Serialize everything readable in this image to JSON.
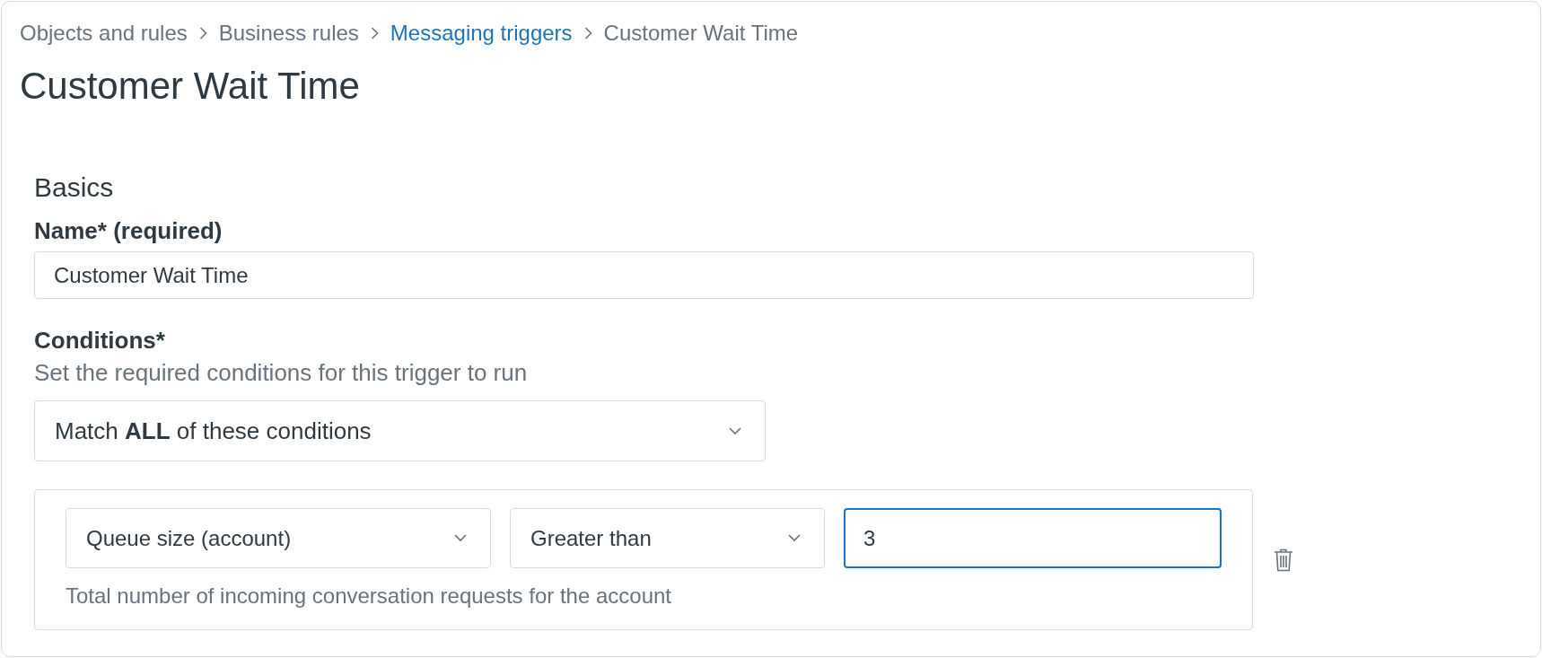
{
  "breadcrumb": [
    {
      "label": "Objects and rules",
      "kind": "text"
    },
    {
      "label": "Business rules",
      "kind": "text"
    },
    {
      "label": "Messaging triggers",
      "kind": "link"
    },
    {
      "label": "Customer Wait Time",
      "kind": "current"
    }
  ],
  "title": "Customer Wait Time",
  "section": "Basics",
  "name_field": {
    "label": "Name* (required)",
    "value": "Customer Wait Time"
  },
  "conditions": {
    "label": "Conditions*",
    "description": "Set the required conditions for this trigger to run",
    "match": "Match **ALL** of these conditions",
    "rows": [
      {
        "field": "Queue size (account)",
        "operator": "Greater than",
        "value": "3",
        "focused": true,
        "hint": "Total number of incoming conversation requests for the account"
      }
    ]
  }
}
